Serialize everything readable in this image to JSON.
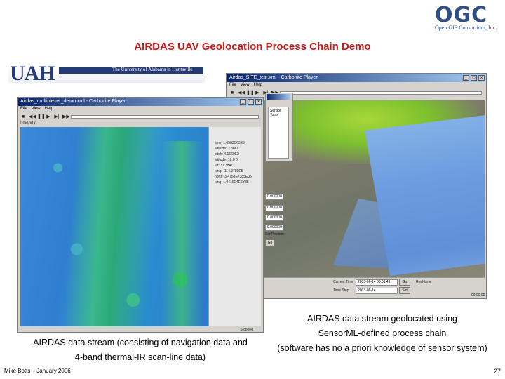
{
  "logo": {
    "letters": "OGC",
    "subtitle": "Open GIS Consortium, Inc."
  },
  "slide": {
    "title": "AIRDAS UAV Geolocation Process Chain Demo",
    "footer": "Mike Botts – January 2006",
    "page_number": "27"
  },
  "uah_banner": {
    "letters": "UAH",
    "tagline": "The University of Alabama in Huntsville"
  },
  "back_window": {
    "title": "Airdas_SITE_test.xml - Carbonite Player",
    "menu": [
      "File",
      "View",
      "Help"
    ],
    "inner_panel_title": "Sensor Tools",
    "controls": {
      "label_time": "Current Time",
      "time_value": "2003-06-14 00:01:49",
      "label_step": "Time Step",
      "step_value": "2003-06-14",
      "realtime_label": "Real-time",
      "btn_go": "Go",
      "btn_set": "Set"
    },
    "side_fields": [
      "0.000000",
      "0.000000",
      "0.000000",
      "0.000000"
    ],
    "side_label": "Set Position",
    "side_btn": "Go",
    "status": "09:00:00"
  },
  "front_window": {
    "title": "Airdas_multiplexer_demo.xml - Carbonite Player",
    "menu": [
      "File",
      "View",
      "Help"
    ],
    "panel_label": "Imagery",
    "metadata": [
      "time: 1.0563C63E9",
      "altitude: 2.8861",
      "pitch: 4.1560E2",
      "altitude: 18.0 0",
      "lat: 31.3841",
      "long: -114.0780E5",
      "north: 3.4758E7385E05",
      "long: 1.9416E4E6Y85"
    ],
    "status": "Stopped"
  },
  "captions": {
    "left_bold": "AIRDAS data stream",
    "left_rest": "(consisting of navigation data and 4-band thermal-IR scan-line data)",
    "right_line1": "AIRDAS data stream geolocated using",
    "right_line2": "SensorML-defined process chain",
    "right_rest": "(software has no a priori knowledge of sensor system)"
  },
  "colors": {
    "title": "#cc1a1a",
    "ogc": "#2f4f84",
    "uah": "#243a74"
  }
}
